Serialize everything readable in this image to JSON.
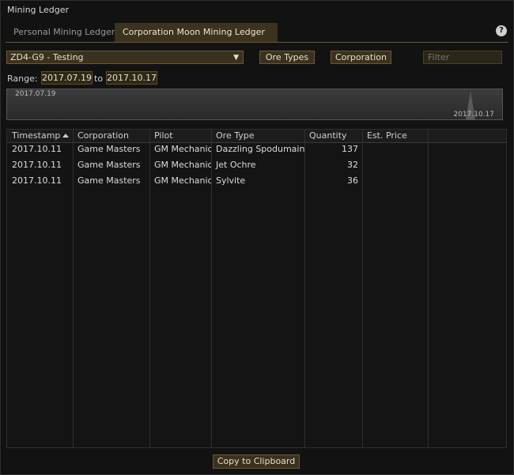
{
  "window": {
    "title": "Mining Ledger"
  },
  "tabs": [
    {
      "label": "Personal Mining Ledger",
      "active": false
    },
    {
      "label": "Corporation Moon Mining Ledger",
      "active": true
    }
  ],
  "help": {
    "label": "?"
  },
  "toolbar": {
    "structure_select": "ZD4-G9 - Testing",
    "ore_types_label": "Ore Types",
    "corporation_label": "Corporation",
    "filter_placeholder": "Filter"
  },
  "range": {
    "label": "Range:",
    "from": "2017.07.19",
    "to_label": "to",
    "to": "2017.10.17"
  },
  "timeline": {
    "start": "2017.07.19",
    "end": "2017.10.17"
  },
  "table": {
    "columns": [
      "Timestamp",
      "Corporation",
      "Pilot",
      "Ore Type",
      "Quantity",
      "Est. Price"
    ],
    "rows": [
      {
        "timestamp": "2017.10.11",
        "corporation": "Game Masters",
        "pilot": "GM Mechanic",
        "ore_type": "Dazzling Spodumain",
        "quantity": "137",
        "price": ""
      },
      {
        "timestamp": "2017.10.11",
        "corporation": "Game Masters",
        "pilot": "GM Mechanic",
        "ore_type": "Jet Ochre",
        "quantity": "32",
        "price": ""
      },
      {
        "timestamp": "2017.10.11",
        "corporation": "Game Masters",
        "pilot": "GM Mechanic",
        "ore_type": "Sylvite",
        "quantity": "36",
        "price": ""
      }
    ]
  },
  "footer": {
    "copy_label": "Copy to Clipboard"
  },
  "colors": {
    "accent": "#6b5a2e",
    "button_bg": "#3a3120",
    "text": "#e8dfc4"
  }
}
